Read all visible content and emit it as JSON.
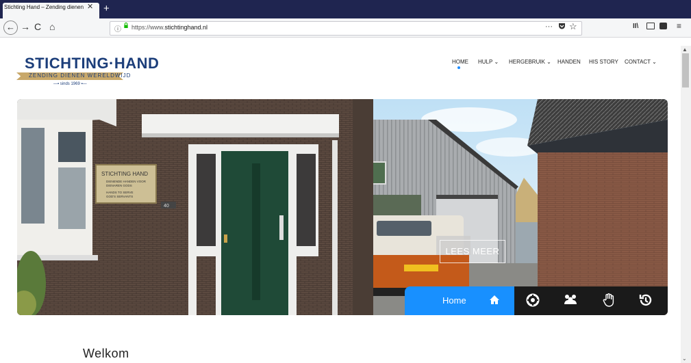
{
  "browser": {
    "tab_title": "Stichting Hand – Zending dienen w",
    "tab_close": "✕",
    "new_tab": "+",
    "url_prefix": "https://www.",
    "url_domain": "stichtinghand.nl",
    "nav_back": "←",
    "nav_forward": "→",
    "nav_reload": "C",
    "nav_home": "⌂",
    "info_icon": "ⓘ",
    "dots": "···",
    "star": "☆",
    "library": "II\\",
    "menu": "≡"
  },
  "site": {
    "logo_title": "STICHTING·HAND",
    "logo_tagline": "ZENDING DIENEN WERELDWIJD",
    "logo_since": "sinds 1969",
    "menu": [
      {
        "label": "HOME",
        "arrow": ""
      },
      {
        "label": "HULP",
        "arrow": "⌄"
      },
      {
        "label": "HERGEBRUIK",
        "arrow": "⌄"
      },
      {
        "label": "HANDEN",
        "arrow": ""
      },
      {
        "label": "HIS STORY",
        "arrow": ""
      },
      {
        "label": "CONTACT",
        "arrow": "⌄"
      }
    ],
    "hero": {
      "sign_text_1": "STICHTING HAND",
      "sign_text_2": "DIENENDE HANDEN VOOR",
      "sign_text_3": "DIENAREN GODS",
      "sign_text_4": "HANDS TO SERVE",
      "sign_text_5": "GOD'S SERVANTS",
      "house_number": "40",
      "plate": "VN-79-VH",
      "cta": "LEES MEER",
      "nav_home_label": "Home"
    },
    "welcome_heading": "Welkom"
  },
  "colors": {
    "tabstrip": "#1f2550",
    "accent": "#1890ff",
    "logo_blue": "#1c3e7a",
    "logo_gold": "#c8a86a"
  },
  "icons": [
    "home-icon",
    "lifebuoy-icon",
    "group-icon",
    "hand-icon",
    "history-icon"
  ]
}
